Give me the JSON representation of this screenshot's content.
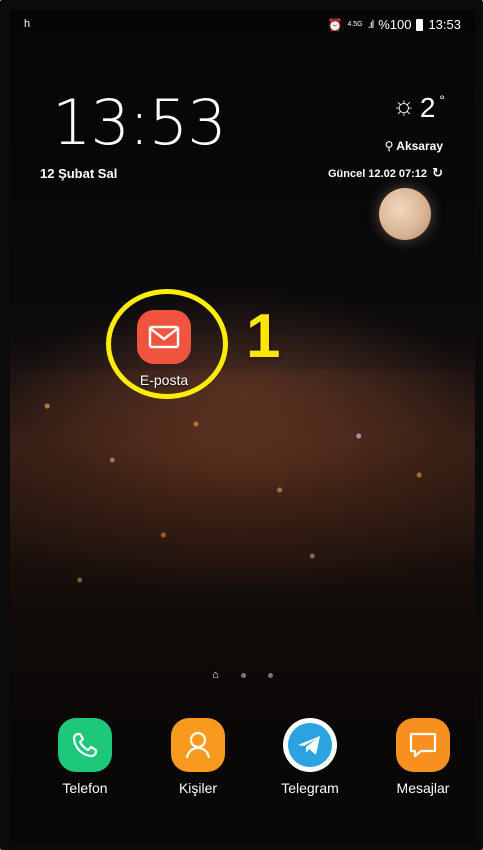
{
  "status_bar": {
    "left_text": "h",
    "network_type": "4.5G",
    "battery": "%100",
    "time": "13:53"
  },
  "clock_widget": {
    "time": "13:53",
    "date": "12 Şubat Sal"
  },
  "weather_widget": {
    "temperature": "2",
    "degree_symbol": "°",
    "location": "Aksaray",
    "updated": "Güncel 12.02 07:12"
  },
  "home_screen_app": {
    "label": "E-posta",
    "icon": "email-envelope-icon",
    "color": "#f0533e"
  },
  "annotation": {
    "step_number": "1",
    "highlight_color": "#ffee00"
  },
  "dock": {
    "apps": [
      {
        "label": "Telefon",
        "icon": "phone-icon",
        "color": "#1ec87a"
      },
      {
        "label": "Kişiler",
        "icon": "contacts-icon",
        "color": "#f79a1e"
      },
      {
        "label": "Telegram",
        "icon": "telegram-icon",
        "color": "#2aa3e0"
      },
      {
        "label": "Mesajlar",
        "icon": "messages-icon",
        "color": "#f7901e"
      }
    ]
  }
}
